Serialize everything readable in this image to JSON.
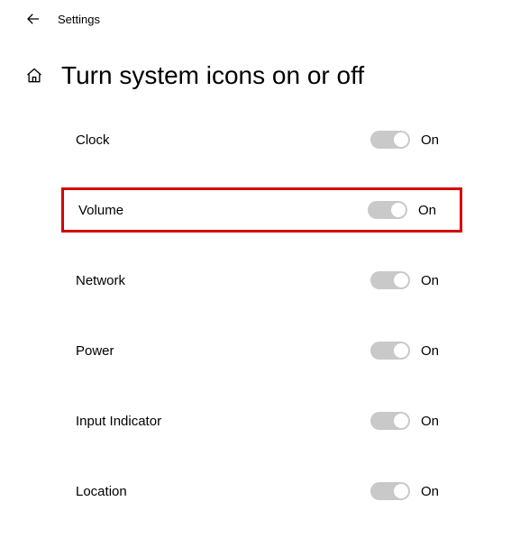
{
  "topbar": {
    "title": "Settings"
  },
  "header": {
    "title": "Turn system icons on or off"
  },
  "items": [
    {
      "label": "Clock",
      "state": "On",
      "highlighted": false
    },
    {
      "label": "Volume",
      "state": "On",
      "highlighted": true
    },
    {
      "label": "Network",
      "state": "On",
      "highlighted": false
    },
    {
      "label": "Power",
      "state": "On",
      "highlighted": false
    },
    {
      "label": "Input Indicator",
      "state": "On",
      "highlighted": false
    },
    {
      "label": "Location",
      "state": "On",
      "highlighted": false
    }
  ]
}
